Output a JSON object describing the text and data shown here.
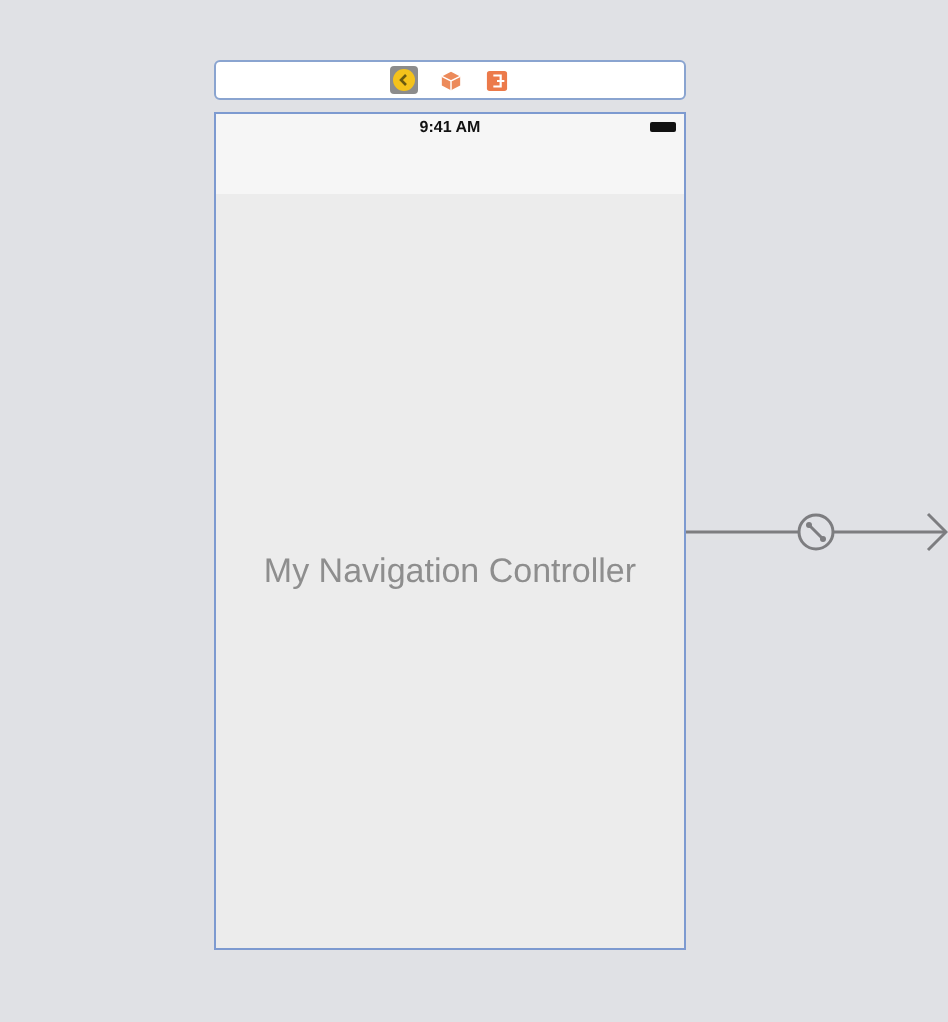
{
  "dock": [
    {
      "kind": "view-controller",
      "selected": true
    },
    {
      "kind": "cube",
      "selected": false
    },
    {
      "kind": "exit",
      "selected": false
    }
  ],
  "scene": {
    "status_bar": {
      "time": "9:41 AM"
    },
    "title": "My Navigation Controller"
  }
}
